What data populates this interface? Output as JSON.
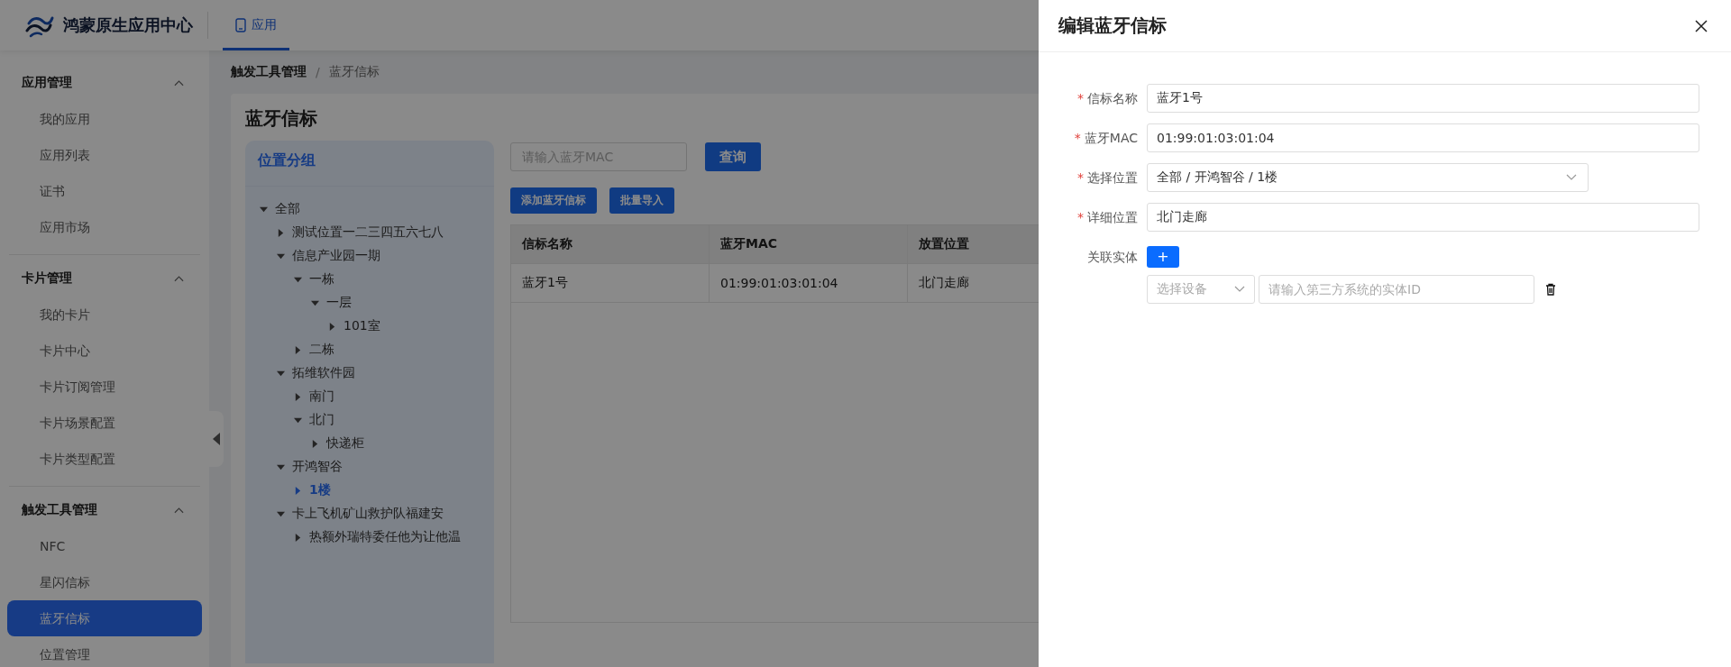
{
  "header": {
    "logo_text": "鸿蒙原生应用中心",
    "nav_tabs": [
      {
        "label": "应用",
        "selected": true
      }
    ]
  },
  "sidebar": {
    "groups": [
      {
        "title": "应用管理",
        "expanded": true,
        "items": [
          {
            "label": "我的应用",
            "selected": false
          },
          {
            "label": "应用列表",
            "selected": false
          },
          {
            "label": "证书",
            "selected": false
          },
          {
            "label": "应用市场",
            "selected": false
          }
        ]
      },
      {
        "title": "卡片管理",
        "expanded": true,
        "items": [
          {
            "label": "我的卡片",
            "selected": false
          },
          {
            "label": "卡片中心",
            "selected": false
          },
          {
            "label": "卡片订阅管理",
            "selected": false
          },
          {
            "label": "卡片场景配置",
            "selected": false
          },
          {
            "label": "卡片类型配置",
            "selected": false
          }
        ]
      },
      {
        "title": "触发工具管理",
        "expanded": true,
        "items": [
          {
            "label": "NFC",
            "selected": false
          },
          {
            "label": "星闪信标",
            "selected": false
          },
          {
            "label": "蓝牙信标",
            "selected": true
          },
          {
            "label": "位置管理",
            "selected": false
          }
        ]
      }
    ]
  },
  "breadcrumb": {
    "items": [
      "触发工具管理",
      "蓝牙信标"
    ],
    "separator": "/"
  },
  "page_title": "蓝牙信标",
  "location_panel": {
    "title": "位置分组",
    "tree": [
      {
        "label": "全部",
        "expanded": true,
        "selected": false,
        "children": [
          {
            "label": "测试位置一二三四五六七八",
            "expanded": false,
            "selected": false
          },
          {
            "label": "信息产业园一期",
            "expanded": true,
            "selected": false,
            "children": [
              {
                "label": "一栋",
                "expanded": true,
                "selected": false,
                "children": [
                  {
                    "label": "一层",
                    "expanded": true,
                    "selected": false,
                    "children": [
                      {
                        "label": "101室",
                        "expanded": false,
                        "selected": false
                      }
                    ]
                  }
                ]
              },
              {
                "label": "二栋",
                "expanded": false,
                "selected": false
              }
            ]
          },
          {
            "label": "拓维软件园",
            "expanded": true,
            "selected": false,
            "children": [
              {
                "label": "南门",
                "expanded": false,
                "selected": false
              },
              {
                "label": "北门",
                "expanded": true,
                "selected": false,
                "children": [
                  {
                    "label": "快递柜",
                    "expanded": false,
                    "selected": false
                  }
                ]
              }
            ]
          },
          {
            "label": "开鸿智谷",
            "expanded": true,
            "selected": false,
            "children": [
              {
                "label": "1楼",
                "expanded": false,
                "selected": true
              }
            ]
          },
          {
            "label": "卡上飞机矿山救护队福建安",
            "expanded": true,
            "selected": false,
            "children": [
              {
                "label": "热额外瑞特委任他为让他温",
                "expanded": false,
                "selected": false
              }
            ]
          }
        ]
      }
    ]
  },
  "search": {
    "placeholder": "请输入蓝牙MAC"
  },
  "query_button": "查询",
  "toolbar_buttons": [
    "添加蓝牙信标",
    "批量导入"
  ],
  "table": {
    "columns": [
      "信标名称",
      "蓝牙MAC",
      "放置位置"
    ],
    "rows": [
      [
        "蓝牙1号",
        "01:99:01:03:01:04",
        "北门走廊"
      ]
    ]
  },
  "drawer": {
    "title": "编辑蓝牙信标",
    "fields": [
      {
        "kind": "input",
        "required_mark": "*",
        "label": "信标名称",
        "value": "蓝牙1号"
      },
      {
        "kind": "input",
        "required_mark": "*",
        "label": "蓝牙MAC",
        "value": "01:99:01:03:01:04"
      },
      {
        "kind": "select",
        "required_mark": "*",
        "label": "选择位置",
        "value": "全部 / 开鸿智谷 / 1楼"
      },
      {
        "kind": "input",
        "required_mark": "*",
        "label": "详细位置",
        "value": "北门走廊"
      }
    ],
    "entity": {
      "label": "关联实体",
      "add_button": "+",
      "device_placeholder": "选择设备",
      "id_placeholder": "请输入第三方系统的实体ID"
    }
  }
}
